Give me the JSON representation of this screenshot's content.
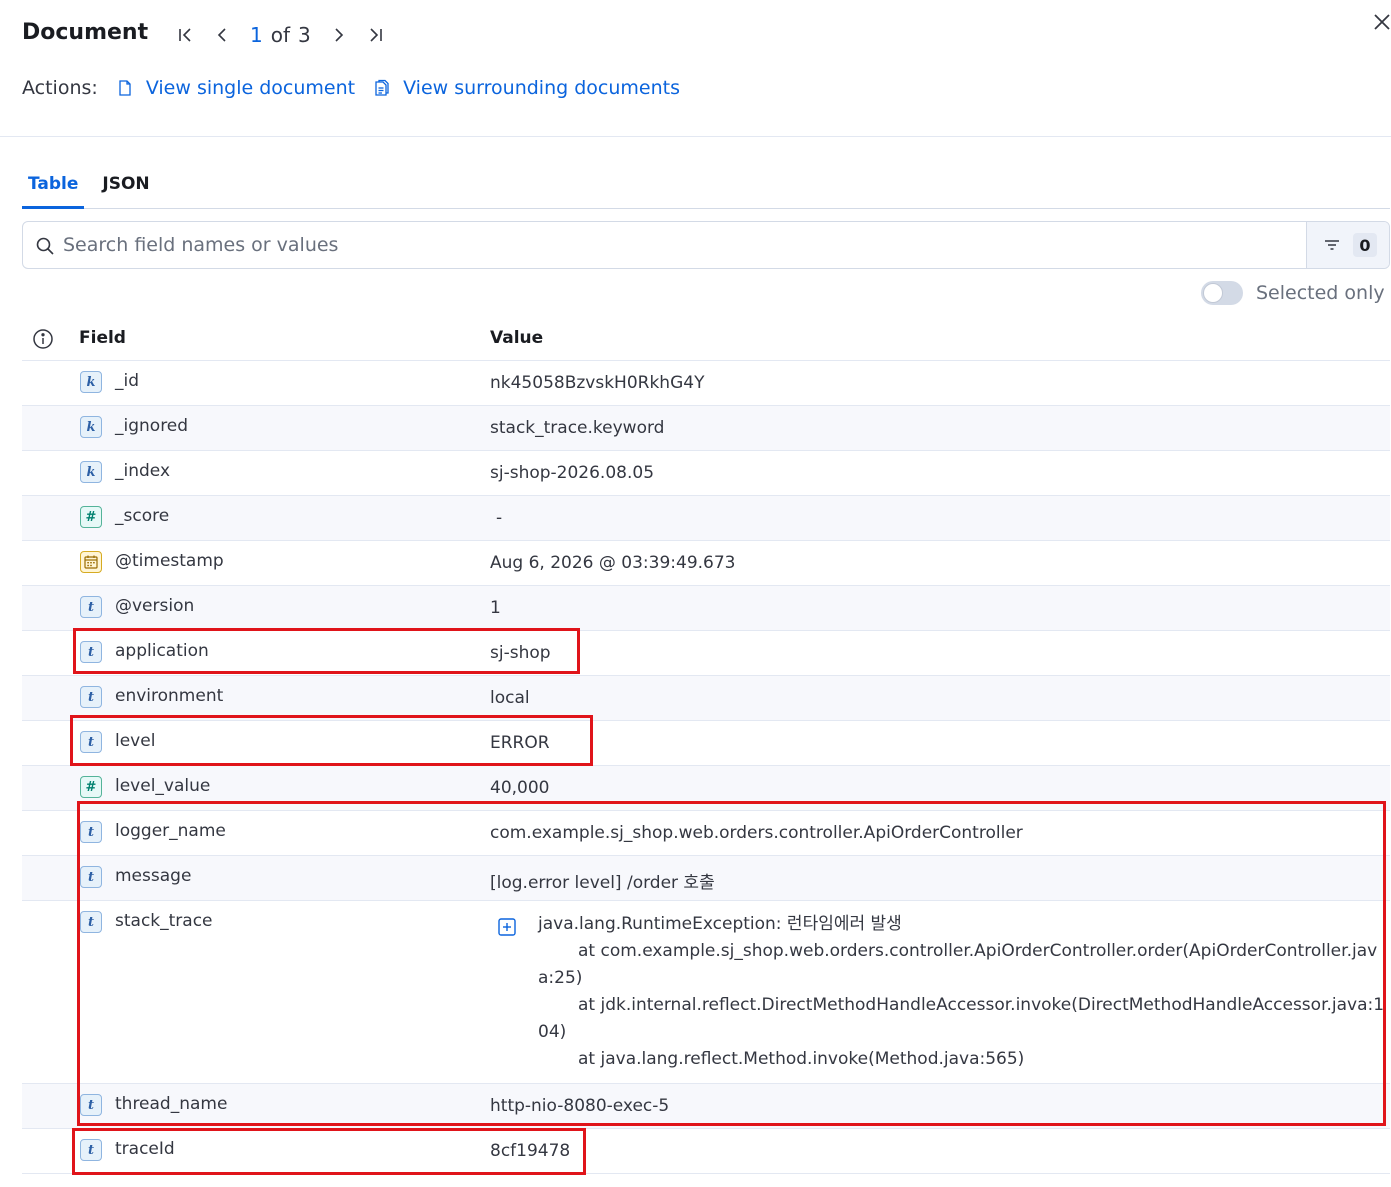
{
  "header": {
    "title": "Document",
    "pager": {
      "current": "1",
      "of_label": "of",
      "total": "3"
    },
    "actions_label": "Actions:",
    "actions": [
      {
        "label": "View single document"
      },
      {
        "label": "View surrounding documents"
      }
    ]
  },
  "tabs": [
    {
      "label": "Table",
      "active": true
    },
    {
      "label": "JSON",
      "active": false
    }
  ],
  "search": {
    "placeholder": "Search field names or values",
    "filter_count": "0"
  },
  "selected_only_label": "Selected only",
  "table": {
    "columns": {
      "field": "Field",
      "value": "Value"
    },
    "rows": [
      {
        "type": "keyword",
        "icon": "k",
        "field": "_id",
        "value": "nk45058BzvskH0RkhG4Y"
      },
      {
        "type": "keyword",
        "icon": "k",
        "field": "_ignored",
        "value": "stack_trace.keyword"
      },
      {
        "type": "keyword",
        "icon": "k",
        "field": "_index",
        "value": "sj-shop-2026.08.05"
      },
      {
        "type": "number",
        "icon": "#",
        "field": "_score",
        "value": "-"
      },
      {
        "type": "date",
        "icon": "calendar-icon",
        "field": "@timestamp",
        "value": "Aug 6, 2026 @ 03:39:49.673"
      },
      {
        "type": "text",
        "icon": "t",
        "field": "@version",
        "value": "1"
      },
      {
        "type": "text",
        "icon": "t",
        "field": "application",
        "value": "sj-shop"
      },
      {
        "type": "text",
        "icon": "t",
        "field": "environment",
        "value": "local"
      },
      {
        "type": "text",
        "icon": "t",
        "field": "level",
        "value": "ERROR"
      },
      {
        "type": "number",
        "icon": "#",
        "field": "level_value",
        "value": "40,000"
      },
      {
        "type": "text",
        "icon": "t",
        "field": "logger_name",
        "value": "com.example.sj_shop.web.orders.controller.ApiOrderController"
      },
      {
        "type": "text",
        "icon": "t",
        "field": "message",
        "value": "[log.error level] /order 호출"
      },
      {
        "type": "text",
        "icon": "t",
        "field": "stack_trace",
        "value_lines": [
          "java.lang.RuntimeException: 런타임에러 발생",
          "at com.example.sj_shop.web.orders.controller.ApiOrderController.order(ApiOrderController.java:25)",
          "at jdk.internal.reflect.DirectMethodHandleAccessor.invoke(DirectMethodHandleAccessor.java:104)",
          "at java.lang.reflect.Method.invoke(Method.java:565)"
        ]
      },
      {
        "type": "text",
        "icon": "t",
        "field": "thread_name",
        "value": "http-nio-8080-exec-5"
      },
      {
        "type": "text",
        "icon": "t",
        "field": "traceId",
        "value": "8cf19478"
      }
    ]
  },
  "colors": {
    "accent": "#0b64dd",
    "highlight": "#e0141a",
    "keyword_icon": "#2c5fa5",
    "number_icon": "#00826f",
    "date_icon": "#d6ab22"
  }
}
